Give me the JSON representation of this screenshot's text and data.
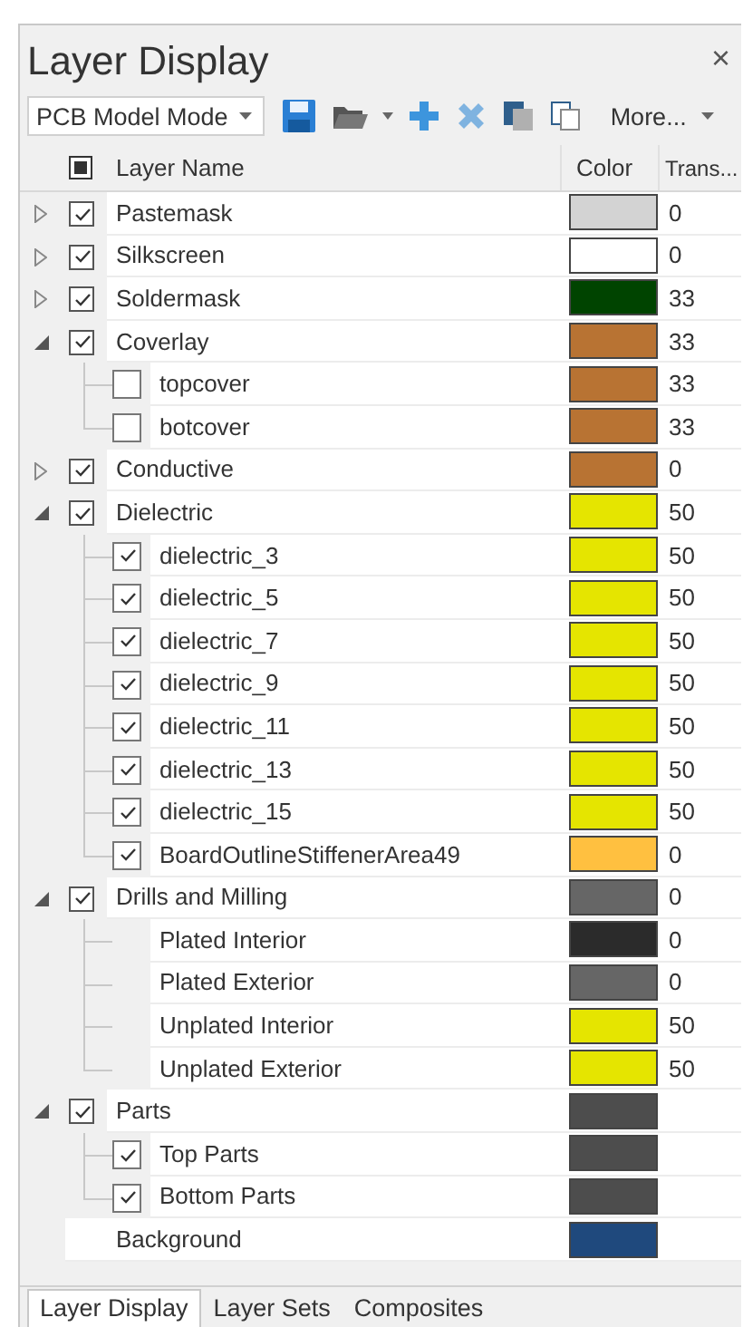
{
  "window": {
    "title": "Layer Display",
    "close": "×"
  },
  "toolbar": {
    "mode": "PCB Model Mode",
    "more": "More..."
  },
  "header": {
    "indeterminate": true,
    "columns": [
      "Layer Name",
      "Color",
      "Trans..."
    ]
  },
  "layers": [
    {
      "name": "Pastemask",
      "kind": "check",
      "checked": true,
      "expanded": false,
      "color": "#d3d3d3",
      "transparency": "0"
    },
    {
      "name": "Silkscreen",
      "kind": "check",
      "checked": true,
      "expanded": false,
      "color": "#ffffff",
      "transparency": "0"
    },
    {
      "name": "Soldermask",
      "kind": "check",
      "checked": true,
      "expanded": false,
      "color": "#004400",
      "transparency": "33"
    },
    {
      "name": "Coverlay",
      "kind": "check",
      "checked": true,
      "expanded": true,
      "color": "#b87333",
      "transparency": "33",
      "children": [
        {
          "name": "topcover",
          "kind": "check",
          "checked": false,
          "color": "#b87333",
          "transparency": "33"
        },
        {
          "name": "botcover",
          "kind": "check",
          "checked": false,
          "color": "#b87333",
          "transparency": "33"
        }
      ]
    },
    {
      "name": "Conductive",
      "kind": "check",
      "checked": true,
      "expanded": false,
      "color": "#b87333",
      "transparency": "0"
    },
    {
      "name": "Dielectric",
      "kind": "check",
      "checked": true,
      "expanded": true,
      "color": "#e5e500",
      "transparency": "50",
      "children": [
        {
          "name": "dielectric_3",
          "kind": "check",
          "checked": true,
          "color": "#e5e500",
          "transparency": "50"
        },
        {
          "name": "dielectric_5",
          "kind": "check",
          "checked": true,
          "color": "#e5e500",
          "transparency": "50"
        },
        {
          "name": "dielectric_7",
          "kind": "check",
          "checked": true,
          "color": "#e5e500",
          "transparency": "50"
        },
        {
          "name": "dielectric_9",
          "kind": "check",
          "checked": true,
          "color": "#e5e500",
          "transparency": "50"
        },
        {
          "name": "dielectric_11",
          "kind": "check",
          "checked": true,
          "color": "#e5e500",
          "transparency": "50"
        },
        {
          "name": "dielectric_13",
          "kind": "check",
          "checked": true,
          "color": "#e5e500",
          "transparency": "50"
        },
        {
          "name": "dielectric_15",
          "kind": "check",
          "checked": true,
          "color": "#e5e500",
          "transparency": "50"
        },
        {
          "name": "BoardOutlineStiffenerArea49",
          "kind": "check",
          "checked": true,
          "color": "#ffc040",
          "transparency": "0"
        }
      ]
    },
    {
      "name": "Drills and Milling",
      "kind": "check",
      "checked": true,
      "expanded": true,
      "color": "#666666",
      "transparency": "0",
      "children": [
        {
          "name": "Plated Interior",
          "kind": "plain",
          "color": "#2b2b2b",
          "transparency": "0"
        },
        {
          "name": "Plated Exterior",
          "kind": "plain",
          "color": "#666666",
          "transparency": "0"
        },
        {
          "name": "Unplated Interior",
          "kind": "plain",
          "color": "#e5e500",
          "transparency": "50"
        },
        {
          "name": "Unplated Exterior",
          "kind": "plain",
          "color": "#e5e500",
          "transparency": "50"
        }
      ]
    },
    {
      "name": "Parts",
      "kind": "check",
      "checked": true,
      "expanded": true,
      "color": "#4d4d4d",
      "children": [
        {
          "name": "Top Parts",
          "kind": "check",
          "checked": true,
          "color": "#4d4d4d"
        },
        {
          "name": "Bottom Parts",
          "kind": "check",
          "checked": true,
          "color": "#4d4d4d"
        }
      ]
    },
    {
      "name": "Background",
      "kind": "plain",
      "color": "#1f497d"
    }
  ],
  "tabs": [
    {
      "label": "Layer Display",
      "selected": true
    },
    {
      "label": "Layer Sets",
      "selected": false
    },
    {
      "label": "Composites",
      "selected": false
    }
  ]
}
